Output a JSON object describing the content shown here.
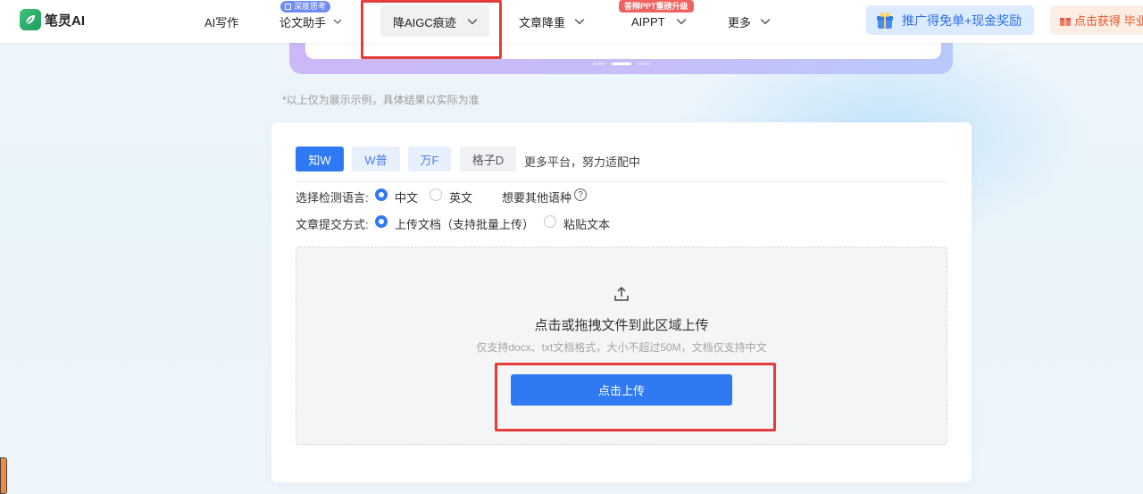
{
  "header": {
    "logo_text": "笔灵AI",
    "nav": [
      {
        "label": "AI写作"
      },
      {
        "label": "论文助手",
        "badge": "深度思考"
      },
      {
        "label": "降AIGC痕迹"
      },
      {
        "label": "文章降重"
      },
      {
        "label": "AIPPT",
        "badge": "答辩PPT重磅升级"
      },
      {
        "label": "更多"
      }
    ],
    "promo_label": "推广得免单+现金奖励",
    "gift_label": "点击获得 毕业"
  },
  "note": "*以上仅为展示示例，具体结果以实际为准",
  "panel": {
    "platform_tabs": [
      "知W",
      "W普",
      "万F",
      "格子D"
    ],
    "more_platforms": "更多平台，努力适配中",
    "language_label": "选择检测语言:",
    "language_options": [
      "中文",
      "英文"
    ],
    "selected_language": "中文",
    "other_language": "想要其他语种",
    "submit_label": "文章提交方式:",
    "submit_options": [
      "上传文档（支持批量上传）",
      "粘贴文本"
    ],
    "selected_submit": "上传文档（支持批量上传）",
    "dropzone_title": "点击或拖拽文件到此区域上传",
    "dropzone_hint": "仅支持docx、txt文档格式，大小不超过50M，文档仅支持中文",
    "upload_button": "点击上传"
  },
  "colors": {
    "accent": "#2f7af3",
    "highlight_box": "#e63c3c",
    "badge_red": "#f0625f",
    "badge_blue": "#6f8cf5"
  }
}
